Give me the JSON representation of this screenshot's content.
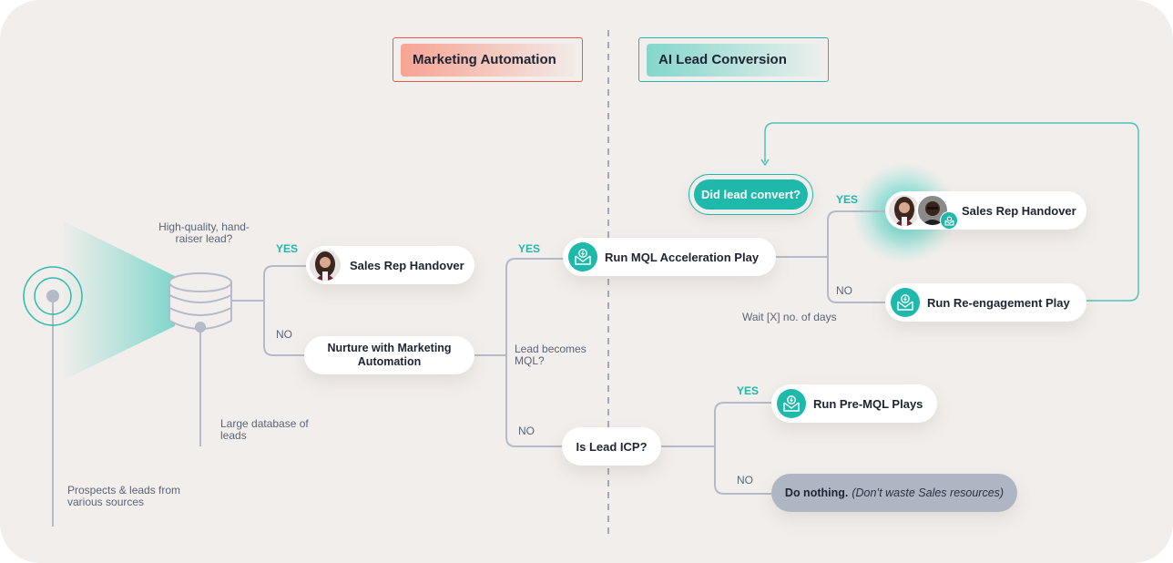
{
  "colors": {
    "background": "#f2eeeb",
    "teal": "#1fb9ac",
    "coral": "#ec5a45",
    "line_gray": "#b3bac8",
    "text_dark": "#1e2433",
    "text_muted": "#5a6478",
    "neutral_node": "#aeb6c4"
  },
  "headers": {
    "marketing": "Marketing Automation",
    "ai": "AI Lead Conversion"
  },
  "labels": {
    "sources": "Prospects & leads from various sources",
    "database": "Large database of leads",
    "high_quality": "High-quality, hand-raiser lead?",
    "becomes_mql": "Lead becomes MQL?",
    "wait": "Wait [X] no. of days",
    "yes": "YES",
    "no": "NO"
  },
  "nodes": {
    "handover_1": "Sales Rep Handover",
    "nurture": "Nurture with Marketing Automation",
    "mql_play": "Run MQL Acceleration Play",
    "is_icp": "Is Lead ICP?",
    "did_convert": "Did lead convert?",
    "handover_2": "Sales Rep Handover",
    "reengage": "Run Re-engagement Play",
    "pre_mql": "Run Pre-MQL Plays",
    "do_nothing_bold": "Do nothing.",
    "do_nothing_note": "(Don’t waste Sales resources)"
  },
  "icons": {
    "source": "broadcast-target-icon",
    "database": "database-icon",
    "play": "envelope-lightning-icon",
    "avatar": "person-avatar"
  }
}
